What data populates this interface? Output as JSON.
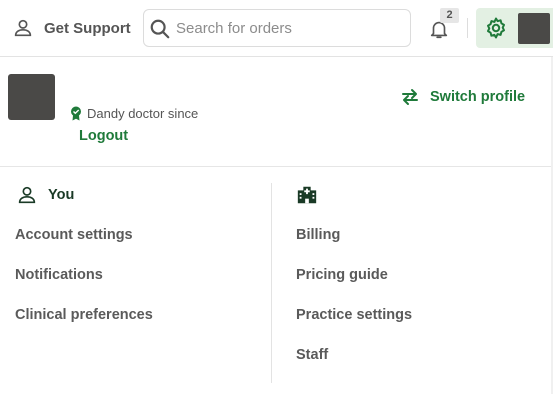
{
  "header": {
    "support_label": "Get Support",
    "search_placeholder": "Search for orders",
    "search_value": "",
    "notification_count": "2"
  },
  "profile": {
    "since_label": "Dandy doctor since",
    "logout_label": "Logout",
    "switch_label": "Switch profile"
  },
  "you_section": {
    "title": "You",
    "items": [
      "Account settings",
      "Notifications",
      "Clinical preferences"
    ]
  },
  "practice_section": {
    "items": [
      "Billing",
      "Pricing guide",
      "Practice settings",
      "Staff"
    ]
  },
  "colors": {
    "accent": "#1f7a3a",
    "settings_bg": "#e3f0e3",
    "avatar": "#4a4947"
  },
  "icons": {
    "support": "person-icon",
    "search": "search-icon",
    "notifications": "bell-icon",
    "settings": "gear-icon",
    "verified": "verified-badge-icon",
    "switch": "swap-arrows-icon",
    "you": "person-icon",
    "practice": "hospital-icon"
  }
}
